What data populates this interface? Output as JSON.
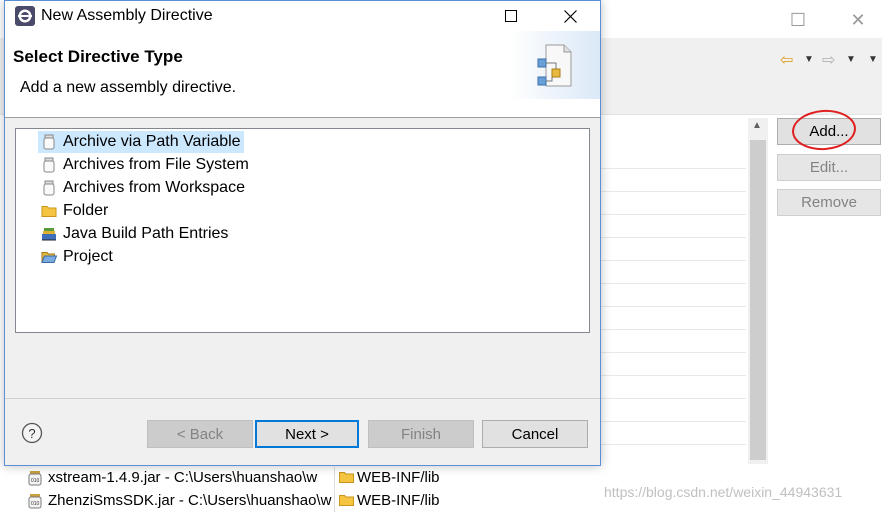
{
  "dialog": {
    "title": "New Assembly Directive",
    "header_title": "Select Directive Type",
    "header_desc": "Add a new assembly directive.",
    "tree_items": [
      {
        "label": "Archive via Path Variable",
        "icon": "jar-icon",
        "selected": true
      },
      {
        "label": "Archives from File System",
        "icon": "jar-icon",
        "selected": false
      },
      {
        "label": "Archives from Workspace",
        "icon": "jar-icon",
        "selected": false
      },
      {
        "label": "Folder",
        "icon": "folder-icon",
        "selected": false
      },
      {
        "label": "Java Build Path Entries",
        "icon": "library-icon",
        "selected": false
      },
      {
        "label": "Project",
        "icon": "open-folder-icon",
        "selected": false
      }
    ],
    "buttons": {
      "back": "< Back",
      "next": "Next >",
      "finish": "Finish",
      "cancel": "Cancel"
    }
  },
  "background": {
    "side_buttons": {
      "add": "Add...",
      "edit": "Edit...",
      "remove": "Remove"
    },
    "rows": [
      {
        "name": "xstream-1.4.9.jar - C:\\Users\\huanshao\\w",
        "path": "WEB-INF/lib"
      },
      {
        "name": "ZhenziSmsSDK.jar - C:\\Users\\huanshao\\w",
        "path": "WEB-INF/lib"
      }
    ],
    "watermark": "https://blog.csdn.net/weixin_44943631"
  }
}
